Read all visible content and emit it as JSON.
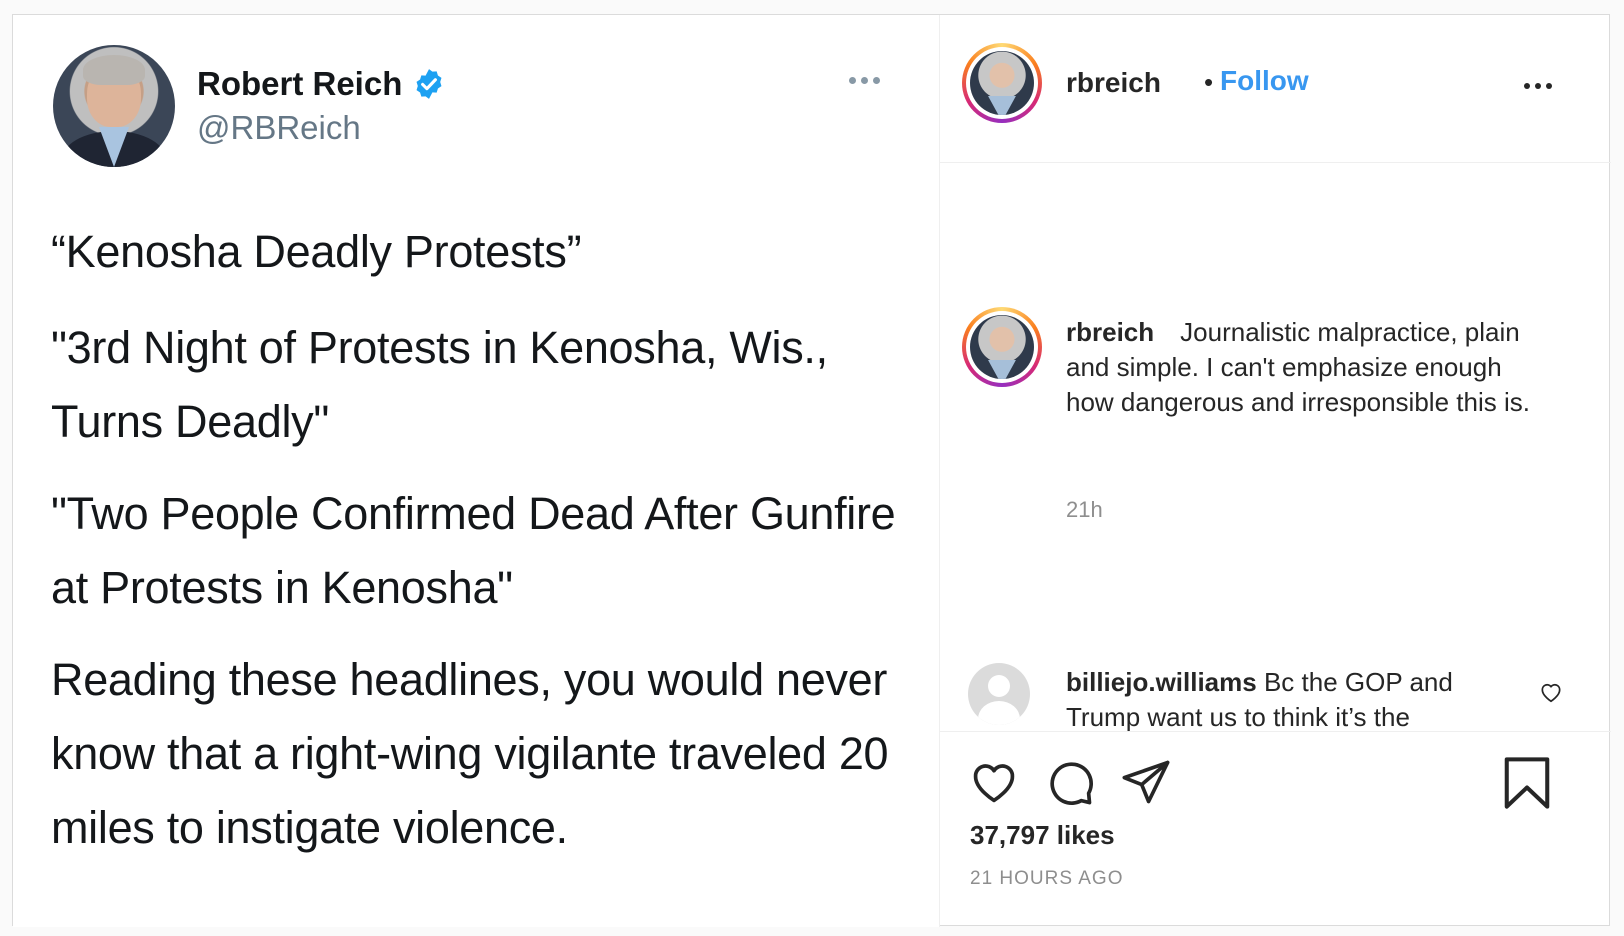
{
  "tweet": {
    "name": "Robert Reich",
    "handle": "@RBReich",
    "paragraphs": [
      "“Kenosha Deadly Protests”",
      "\"3rd Night of Protests in Kenosha, Wis., Turns Deadly\"",
      "\"Two People Confirmed Dead After Gunfire at Protests in Kenosha\"",
      "Reading these headlines, you would never know that a right-wing vigilante traveled 20 miles to instigate violence."
    ]
  },
  "instagram": {
    "username": "rbreich",
    "separator": "•",
    "follow_label": "Follow",
    "caption": {
      "username": "rbreich",
      "text": "Journalistic malpractice, plain and simple. I can't emphasize enough how dangerous and irresponsible this is.",
      "time": "21h"
    },
    "comment": {
      "username": "billiejo.williams",
      "text": "Bc the GOP and Trump want us to think it’s the"
    },
    "likes": "37,797 likes",
    "posted": "21 HOURS AGO"
  },
  "colors": {
    "follow_blue": "#3897f0",
    "verified_blue": "#1da1f2",
    "muted_gray": "#8e8e8e"
  },
  "icons": [
    "verified-badge-icon",
    "more-options-icon",
    "heart-icon",
    "comment-icon",
    "share-icon",
    "bookmark-icon"
  ]
}
